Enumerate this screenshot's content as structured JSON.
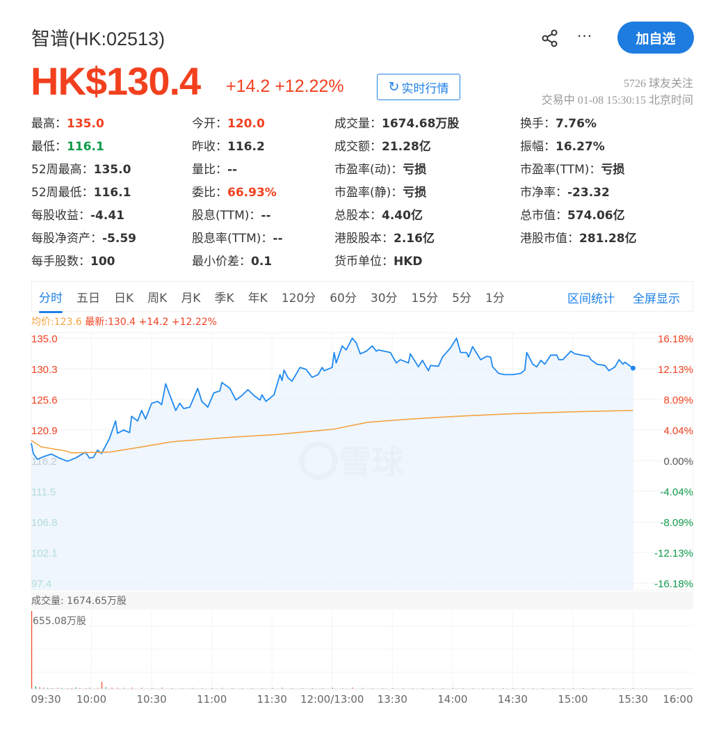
{
  "header": {
    "title": "智谱(HK:02513)",
    "price": "HK$130.4",
    "change": "+14.2 +12.22%",
    "realtime_label": "实时行情",
    "follow_label": "加自选",
    "fans": "5726 球友关注",
    "status": "交易中 01-08 15:30:15 北京时间",
    "more": "···"
  },
  "stats": [
    [
      {
        "k": "最高：",
        "v": "135.0",
        "c": "red"
      },
      {
        "k": "今开：",
        "v": "120.0",
        "c": "red"
      },
      {
        "k": "成交量：",
        "v": "1674.68万股"
      },
      {
        "k": "换手：",
        "v": "7.76%"
      }
    ],
    [
      {
        "k": "最低：",
        "v": "116.1",
        "c": "green"
      },
      {
        "k": "昨收：",
        "v": "116.2"
      },
      {
        "k": "成交额：",
        "v": "21.28亿"
      },
      {
        "k": "振幅：",
        "v": "16.27%"
      }
    ],
    [
      {
        "k": "52周最高：",
        "v": "135.0"
      },
      {
        "k": "量比：",
        "v": "--"
      },
      {
        "k": "市盈率(动)：",
        "v": "亏损"
      },
      {
        "k": "市盈率(TTM)：",
        "v": "亏损"
      }
    ],
    [
      {
        "k": "52周最低：",
        "v": "116.1"
      },
      {
        "k": "委比：",
        "v": "66.93%",
        "c": "red"
      },
      {
        "k": "市盈率(静)：",
        "v": "亏损"
      },
      {
        "k": "市净率：",
        "v": "-23.32"
      }
    ],
    [
      {
        "k": "每股收益：",
        "v": "-4.41"
      },
      {
        "k": "股息(TTM)：",
        "v": "--"
      },
      {
        "k": "总股本：",
        "v": "4.40亿"
      },
      {
        "k": "总市值：",
        "v": "574.06亿"
      }
    ],
    [
      {
        "k": "每股净资产：",
        "v": "-5.59"
      },
      {
        "k": "股息率(TTM)：",
        "v": "--"
      },
      {
        "k": "港股股本：",
        "v": "2.16亿"
      },
      {
        "k": "港股市值：",
        "v": "281.28亿"
      }
    ],
    [
      {
        "k": "每手股数：",
        "v": "100"
      },
      {
        "k": "最小价差：",
        "v": "0.1"
      },
      {
        "k": "货币单位：",
        "v": "HKD"
      }
    ]
  ],
  "tabs": [
    "分时",
    "五日",
    "日K",
    "周K",
    "月K",
    "季K",
    "年K",
    "120分",
    "60分",
    "30分",
    "15分",
    "5分",
    "1分"
  ],
  "tab_right": [
    "区间统计",
    "全屏显示"
  ],
  "legend": {
    "avg": "均价:123.6",
    "latest": "最新:130.4 +14.2 +12.22%"
  },
  "watermark": "雪球",
  "colors": {
    "red": "#f2401f",
    "green": "#0e9a4a",
    "blue": "#1e80e6",
    "avg": "#f5a340"
  },
  "chart_data": {
    "type": "line",
    "prev_close": 116.2,
    "ylim": [
      97.4,
      135.0
    ],
    "y_ticks": [
      "135.0",
      "130.3",
      "125.6",
      "120.9",
      "116.2",
      "111.5",
      "106.8",
      "102.1",
      "97.4"
    ],
    "pct_ticks": [
      "16.18%",
      "12.13%",
      "8.09%",
      "4.04%",
      "0.00%",
      "-4.04%",
      "-8.09%",
      "-12.13%",
      "-16.18%"
    ],
    "x_ticks": [
      "09:30",
      "10:00",
      "10:30",
      "11:00",
      "11:30",
      "12:00/13:00",
      "13:30",
      "14:00",
      "14:30",
      "15:00",
      "15:30",
      "16:00"
    ],
    "total_minutes": 330,
    "price": [
      [
        0,
        118.9
      ],
      [
        1,
        117.3
      ],
      [
        3,
        116.4
      ],
      [
        6,
        116.8
      ],
      [
        10,
        117.2
      ],
      [
        14,
        116.6
      ],
      [
        18,
        116.1
      ],
      [
        22,
        116.6
      ],
      [
        27,
        117.5
      ],
      [
        29,
        116.6
      ],
      [
        31,
        116.7
      ],
      [
        33,
        117.8
      ],
      [
        35,
        117.3
      ],
      [
        39,
        119.6
      ],
      [
        42,
        122.3
      ],
      [
        43,
        120.4
      ],
      [
        46,
        120.9
      ],
      [
        49,
        120.5
      ],
      [
        50,
        123.0
      ],
      [
        53,
        122.3
      ],
      [
        55,
        123.9
      ],
      [
        57,
        122.6
      ],
      [
        60,
        125.0
      ],
      [
        63,
        125.3
      ],
      [
        65,
        124.8
      ],
      [
        67,
        128.0
      ],
      [
        69,
        126.3
      ],
      [
        72,
        123.9
      ],
      [
        74,
        125.0
      ],
      [
        76,
        124.2
      ],
      [
        79,
        124.4
      ],
      [
        83,
        127.3
      ],
      [
        85,
        125.3
      ],
      [
        88,
        124.4
      ],
      [
        91,
        126.6
      ],
      [
        94,
        126.9
      ],
      [
        95,
        128.2
      ],
      [
        99,
        127.3
      ],
      [
        102,
        125.5
      ],
      [
        105,
        126.2
      ],
      [
        108,
        127.1
      ],
      [
        111,
        126.2
      ],
      [
        114,
        125.5
      ],
      [
        115,
        126.3
      ],
      [
        117,
        125.3
      ],
      [
        121,
        126.3
      ],
      [
        124,
        129.4
      ],
      [
        125,
        128.5
      ],
      [
        126,
        130.1
      ],
      [
        128,
        128.9
      ],
      [
        130,
        128.4
      ],
      [
        134,
        130.5
      ],
      [
        137,
        130.2
      ],
      [
        140,
        129.0
      ],
      [
        143,
        129.4
      ],
      [
        145,
        130.5
      ],
      [
        146,
        130.0
      ],
      [
        150,
        130.5
      ],
      [
        151,
        132.8
      ],
      [
        152,
        131.2
      ],
      [
        155,
        133.8
      ],
      [
        157,
        133.2
      ],
      [
        160,
        135.0
      ],
      [
        162,
        134.3
      ],
      [
        164,
        132.6
      ],
      [
        167,
        133.0
      ],
      [
        170,
        133.8
      ],
      [
        172,
        133.0
      ],
      [
        173,
        133.2
      ],
      [
        179,
        132.8
      ],
      [
        182,
        131.2
      ],
      [
        184,
        131.7
      ],
      [
        188,
        131.2
      ],
      [
        189,
        132.6
      ],
      [
        193,
        130.6
      ],
      [
        195,
        131.6
      ],
      [
        198,
        130.0
      ],
      [
        199,
        130.8
      ],
      [
        203,
        130.7
      ],
      [
        205,
        132.1
      ],
      [
        209,
        133.5
      ],
      [
        212,
        135.0
      ],
      [
        214,
        132.8
      ],
      [
        217,
        132.8
      ],
      [
        218,
        132.1
      ],
      [
        220,
        133.7
      ],
      [
        224,
        131.7
      ],
      [
        227,
        132.2
      ],
      [
        229,
        132.1
      ],
      [
        230,
        130.6
      ],
      [
        233,
        129.6
      ],
      [
        236,
        129.4
      ],
      [
        240,
        129.4
      ],
      [
        244,
        129.6
      ],
      [
        246,
        130.1
      ],
      [
        247,
        132.8
      ],
      [
        250,
        131.0
      ],
      [
        252,
        130.6
      ],
      [
        254,
        131.6
      ],
      [
        256,
        131.0
      ],
      [
        259,
        132.4
      ],
      [
        262,
        132.4
      ],
      [
        263,
        131.7
      ],
      [
        265,
        131.7
      ],
      [
        269,
        133.0
      ],
      [
        271,
        132.6
      ],
      [
        278,
        132.2
      ],
      [
        279,
        131.7
      ],
      [
        282,
        131.0
      ],
      [
        286,
        130.8
      ],
      [
        288,
        130.0
      ],
      [
        291,
        130.6
      ],
      [
        293,
        131.7
      ],
      [
        295,
        131.0
      ],
      [
        296,
        131.3
      ],
      [
        300,
        130.4
      ]
    ],
    "avg_price": [
      [
        0,
        119.3
      ],
      [
        5,
        118.3
      ],
      [
        17,
        117.7
      ],
      [
        20,
        117.4
      ],
      [
        39,
        117.5
      ],
      [
        55,
        118.3
      ],
      [
        70,
        119.1
      ],
      [
        100,
        119.8
      ],
      [
        122,
        120.2
      ],
      [
        150,
        121.0
      ],
      [
        168,
        122.1
      ],
      [
        190,
        122.6
      ],
      [
        212,
        123.0
      ],
      [
        240,
        123.4
      ],
      [
        270,
        123.7
      ],
      [
        300,
        123.9
      ]
    ],
    "volume_label": "成交量: 1674.65万股",
    "volume_max_label": "655.08万股",
    "volume_max": 655.08,
    "volume": [
      [
        0,
        655.08
      ],
      [
        2,
        22
      ],
      [
        4,
        14
      ],
      [
        6,
        10
      ],
      [
        8,
        8
      ],
      [
        10,
        6
      ],
      [
        13,
        9
      ],
      [
        15,
        7
      ],
      [
        18,
        5
      ],
      [
        20,
        6
      ],
      [
        22,
        12
      ],
      [
        24,
        8
      ],
      [
        27,
        6
      ],
      [
        29,
        9
      ],
      [
        33,
        8
      ],
      [
        35,
        58
      ],
      [
        37,
        14
      ],
      [
        40,
        10
      ],
      [
        43,
        9
      ],
      [
        46,
        8
      ],
      [
        50,
        11
      ],
      [
        55,
        9
      ],
      [
        60,
        8
      ],
      [
        65,
        10
      ],
      [
        70,
        7
      ],
      [
        75,
        6
      ],
      [
        80,
        8
      ],
      [
        85,
        6
      ],
      [
        90,
        7
      ],
      [
        95,
        8
      ],
      [
        100,
        6
      ],
      [
        105,
        5
      ],
      [
        110,
        7
      ],
      [
        115,
        6
      ],
      [
        120,
        8
      ],
      [
        125,
        9
      ],
      [
        130,
        7
      ],
      [
        135,
        6
      ],
      [
        140,
        7
      ],
      [
        145,
        6
      ],
      [
        150,
        9
      ],
      [
        155,
        7
      ],
      [
        160,
        10
      ],
      [
        165,
        8
      ],
      [
        170,
        6
      ],
      [
        175,
        5
      ],
      [
        180,
        6
      ],
      [
        185,
        5
      ],
      [
        190,
        6
      ],
      [
        195,
        5
      ],
      [
        200,
        6
      ],
      [
        205,
        5
      ],
      [
        210,
        8
      ],
      [
        215,
        6
      ],
      [
        220,
        5
      ],
      [
        225,
        6
      ],
      [
        230,
        5
      ],
      [
        235,
        6
      ],
      [
        240,
        5
      ],
      [
        245,
        7
      ],
      [
        250,
        5
      ],
      [
        255,
        4
      ],
      [
        260,
        5
      ],
      [
        265,
        4
      ],
      [
        270,
        5
      ],
      [
        275,
        4
      ],
      [
        280,
        5
      ],
      [
        285,
        4
      ],
      [
        290,
        5
      ],
      [
        295,
        4
      ],
      [
        300,
        6
      ]
    ]
  }
}
